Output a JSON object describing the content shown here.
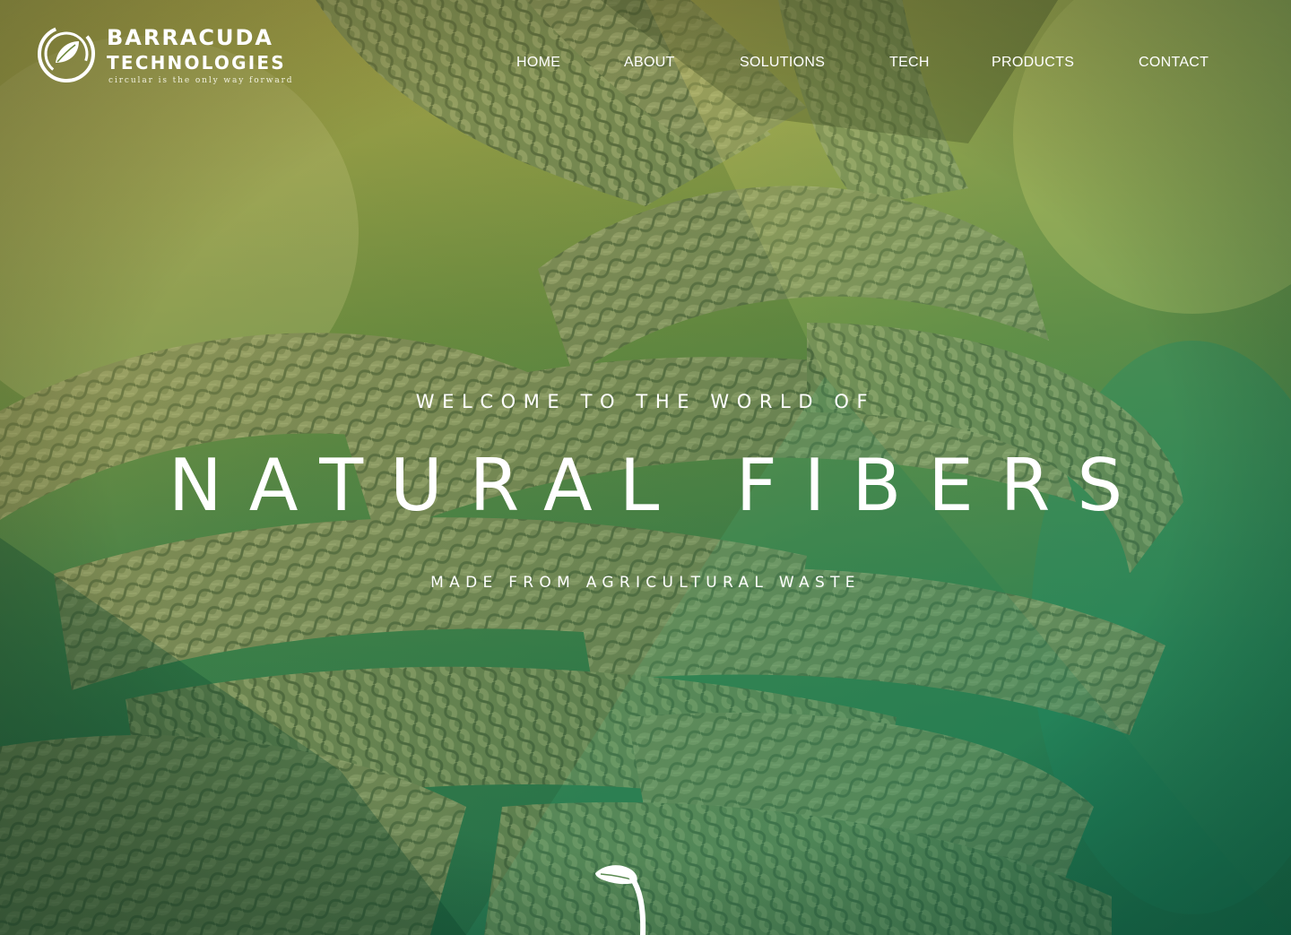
{
  "brand": {
    "name_line1": "BARRACUDA",
    "name_line2": "TECHNOLOGIES",
    "tagline": "circular is the only way forward"
  },
  "nav": {
    "items": [
      {
        "label": "HOME"
      },
      {
        "label": "ABOUT"
      },
      {
        "label": "SOLUTIONS"
      },
      {
        "label": "TECH"
      },
      {
        "label": "PRODUCTS"
      },
      {
        "label": "CONTACT"
      }
    ]
  },
  "hero": {
    "eyebrow": "WELCOME TO THE WORLD OF",
    "title": "NATURAL FIBERS",
    "subtitle": "MADE FROM AGRICULTURAL WASTE",
    "background_subject": "braided-rope-knot",
    "scroll_icon": "sprout-icon"
  },
  "colors": {
    "top_gradient": "#c8b54a",
    "bottom_gradient": "#1d7a55",
    "text": "#ffffff"
  }
}
